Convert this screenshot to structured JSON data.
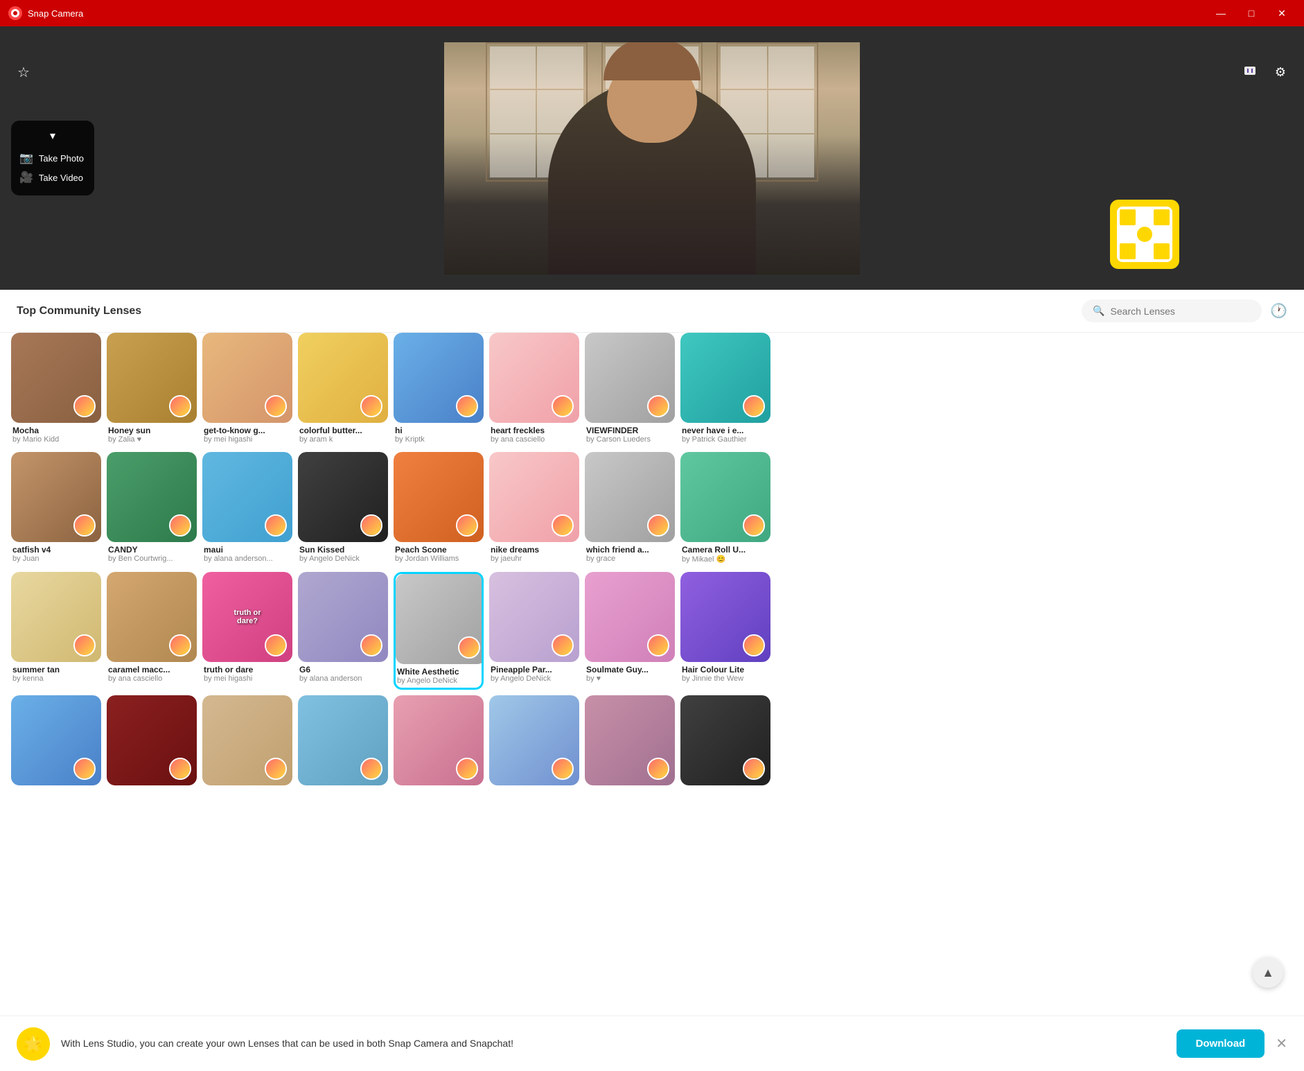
{
  "app": {
    "title": "Snap Camera",
    "icon": "📷"
  },
  "window_controls": {
    "minimize": "—",
    "maximize": "□",
    "close": "✕"
  },
  "toolbar": {
    "star_label": "★",
    "twitch_icon": "twitch",
    "settings_icon": "⚙"
  },
  "camera_controls": {
    "chevron": "▾",
    "take_photo": "Take Photo",
    "take_video": "Take Video"
  },
  "search": {
    "section_title": "Top Community Lenses",
    "placeholder": "Search Lenses"
  },
  "lenses_row1": [
    {
      "name": "Mocha",
      "author": "by Mario Kidd",
      "color": "lt-mocha"
    },
    {
      "name": "Honey sun",
      "author": "by Zalia ♥",
      "color": "lt-honey"
    },
    {
      "name": "get-to-know g...",
      "author": "by mei higashi",
      "color": "lt-warm"
    },
    {
      "name": "colorful butter...",
      "author": "by aram k",
      "color": "lt-yellow"
    },
    {
      "name": "hi",
      "author": "by Kriptk",
      "color": "lt-blue"
    },
    {
      "name": "heart freckles",
      "author": "by ana casciello",
      "color": "lt-light-pink"
    },
    {
      "name": "VIEWFINDER",
      "author": "by Carson Lueders",
      "color": "lt-gray"
    },
    {
      "name": "never have i e...",
      "author": "by Patrick Gauthier",
      "color": "lt-teal"
    }
  ],
  "lenses_row2": [
    {
      "name": "catfish v4",
      "author": "by Juan",
      "color": "lt-brown"
    },
    {
      "name": "CANDY",
      "author": "by Ben Courtwrig...",
      "color": "lt-green"
    },
    {
      "name": "maui",
      "author": "by alana anderson...",
      "color": "lt-beach"
    },
    {
      "name": "Sun Kissed",
      "author": "by Angelo DeNick",
      "color": "lt-dark"
    },
    {
      "name": "Peach Scone",
      "author": "by Jordan Williams",
      "color": "lt-orange"
    },
    {
      "name": "nike dreams",
      "author": "by jaeuhr",
      "color": "lt-light-pink"
    },
    {
      "name": "which friend a...",
      "author": "by grace",
      "color": "lt-gray"
    },
    {
      "name": "Camera Roll U...",
      "author": "by Mikael 😊",
      "color": "lt-colorful"
    }
  ],
  "lenses_row3": [
    {
      "name": "summer tan",
      "author": "by kenna",
      "color": "lt-summer"
    },
    {
      "name": "caramel macc...",
      "author": "by ana casciello",
      "color": "lt-caramel"
    },
    {
      "name": "truth or dare",
      "author": "by mei higashi",
      "color": "lt-truth",
      "overlay": "truth or dare?"
    },
    {
      "name": "G6",
      "author": "by alana anderson",
      "color": "lt-g6"
    },
    {
      "name": "White Aesthetic",
      "author": "by Angelo DeNick",
      "color": "lt-gray",
      "selected": true
    },
    {
      "name": "Pineapple Par...",
      "author": "by Angelo DeNick",
      "color": "lt-pineapple"
    },
    {
      "name": "Soulmate Guy...",
      "author": "by ♥",
      "color": "lt-soulmate"
    },
    {
      "name": "Hair Colour Lite",
      "author": "by Jinnie the Wew",
      "color": "lt-hair"
    }
  ],
  "lenses_row4": [
    {
      "name": "",
      "author": "",
      "color": "lt-blue"
    },
    {
      "name": "",
      "author": "",
      "color": "lt-dark-red"
    },
    {
      "name": "",
      "author": "",
      "color": "lt-sand"
    },
    {
      "name": "",
      "author": "",
      "color": "lt-splash"
    },
    {
      "name": "",
      "author": "",
      "color": "lt-rose"
    },
    {
      "name": "",
      "author": "",
      "color": "lt-butterfly"
    },
    {
      "name": "",
      "author": "",
      "color": "lt-mauve"
    },
    {
      "name": "",
      "author": "",
      "color": "lt-dark"
    }
  ],
  "notification": {
    "icon": "🌟",
    "text": "With Lens Studio, you can create your own Lenses that can be used in both Snap Camera and Snapchat!",
    "download_label": "Download",
    "close_label": "✕"
  }
}
